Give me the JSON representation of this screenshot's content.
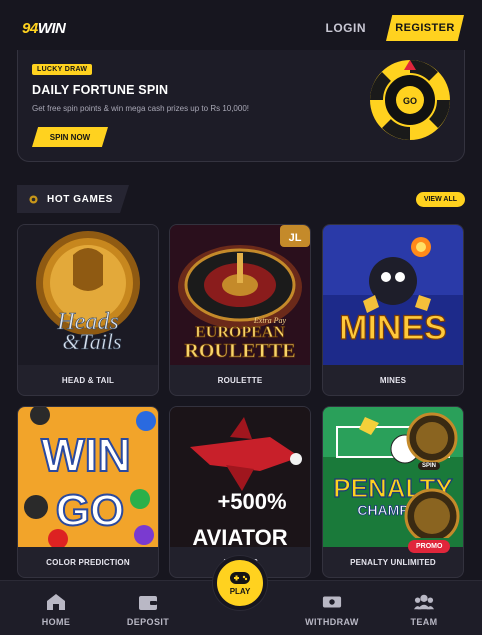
{
  "header": {
    "logo_number": "94",
    "logo_word": "WIN",
    "login_label": "LOGIN",
    "register_label": "REGISTER"
  },
  "promo_card": {
    "badge": "LUCKY DRAW",
    "title": "DAILY FORTUNE SPIN",
    "description": "Get free spin points & win mega cash prizes up to Rs 10,000!",
    "button_label": "SPIN NOW",
    "wheel_label": "GO"
  },
  "hot_games": {
    "title": "HOT GAMES",
    "view_all_label": "VIEW ALL",
    "games": [
      {
        "label": "HEAD & TAIL",
        "art_line1": "Heads",
        "art_line2": "&Tails"
      },
      {
        "label": "ROULETTE",
        "art_top": "Extra Pay",
        "art_line1": "EUROPEAN",
        "art_line2": "ROULETTE",
        "corner": "JL"
      },
      {
        "label": "MINES",
        "art_line1": "MINES"
      },
      {
        "label": "COLOR PREDICTION",
        "art_line1": "WIN",
        "art_line2": "GO"
      },
      {
        "label": "AVIATOR",
        "art_line1": "+500%",
        "art_line2": "AVIATOR"
      },
      {
        "label": "PENALTY UNLIMITED",
        "art_line1": "PENALTY",
        "art_line2": "CHAMP"
      }
    ]
  },
  "floating": {
    "spin_label": "SPIN",
    "promo_label": "PROMO"
  },
  "bottom_nav": {
    "home": "HOME",
    "deposit": "DEPOSIT",
    "play": "PLAY",
    "withdraw": "WITHDRAW",
    "team": "TEAM"
  },
  "colors": {
    "background": "#17161f",
    "accent": "#ffd21f",
    "promo_red": "#e0263b"
  }
}
